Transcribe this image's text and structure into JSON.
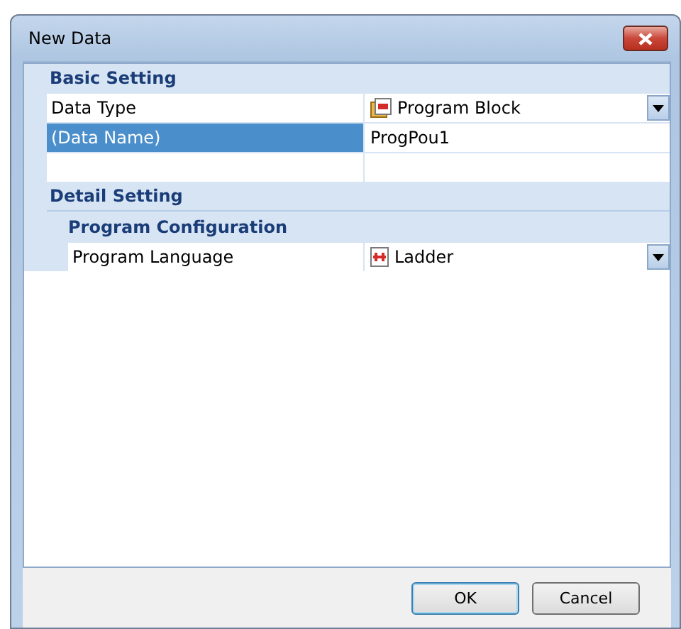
{
  "window": {
    "title": "New Data"
  },
  "categories": [
    {
      "title": "Basic Setting",
      "groups": [
        {
          "properties": [
            {
              "label": "Data Type",
              "value": "Program Block",
              "kind": "block",
              "selected": false
            },
            {
              "label": "(Data Name)",
              "value": "ProgPou1",
              "kind": "text",
              "selected": true
            }
          ]
        }
      ]
    },
    {
      "title": "Detail Setting",
      "groups": [
        {
          "title": "Program Configuration",
          "properties": [
            {
              "label": "Program Language",
              "value": "Ladder",
              "kind": "ladder",
              "selected": false
            }
          ]
        }
      ]
    }
  ],
  "buttons": [
    {
      "label": "OK",
      "default": true
    },
    {
      "label": "Cancel",
      "default": false
    }
  ]
}
